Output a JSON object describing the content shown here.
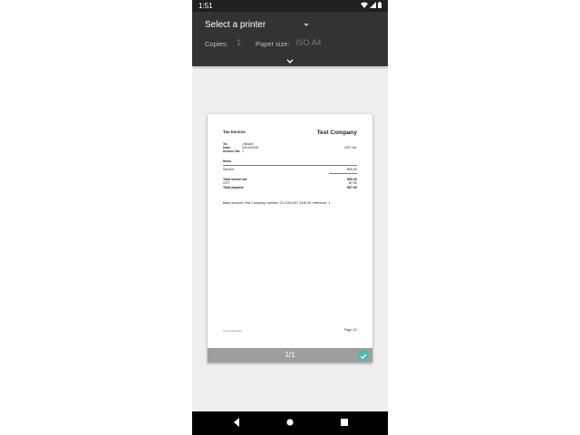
{
  "status_bar": {
    "time": "1:51",
    "icons": [
      "wifi-icon",
      "signal-icon",
      "battery-icon"
    ]
  },
  "print_options": {
    "printer_label": "Select a printer",
    "copies_label": "Copies:",
    "copies_value": "1",
    "paper_size_label": "Paper size:",
    "paper_size_value": "ISO A4"
  },
  "preview": {
    "title": "Tax Invoice",
    "company": "Test Company",
    "to_label": "To:",
    "to_value": "J Board",
    "date_label": "Date:",
    "date_value": "24/10/2025",
    "invoice_no_label": "Invoice No:",
    "invoice_no_value": "1",
    "gst_label": "GST No:",
    "items_header": "Items",
    "item_name": "Service",
    "item_amount": "$50.00",
    "total_before_tax_label": "Total before tax",
    "total_before_tax_value": "$50.00",
    "gst_row_label": "GST",
    "gst_row_value": "$7.50",
    "total_payable_label": "Total payable",
    "total_payable_value": "$57.50",
    "bank_account": "Bank account: Test Company, number: 01-1234-007 2345-00, reference: 1",
    "footer_left": "Invoice generated",
    "page_label": "Page 1/1",
    "page_count": "1/1"
  },
  "colors": {
    "toolbar": "#333333",
    "accent_check": "#4fb7ae",
    "preview_background": "#eeeeee"
  }
}
